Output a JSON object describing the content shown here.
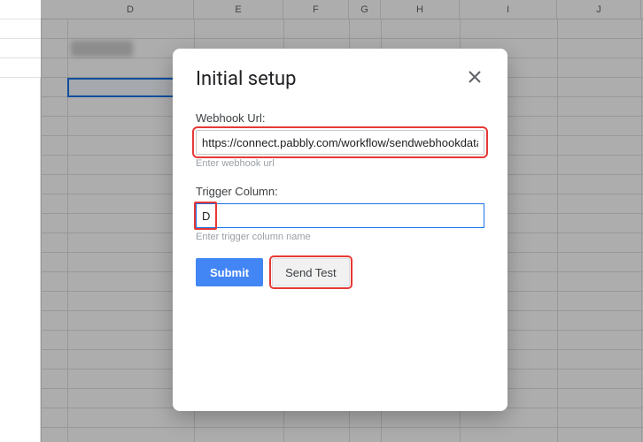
{
  "columns": {
    "D": "D",
    "E": "E",
    "F": "F",
    "G": "G",
    "H": "H",
    "I": "I",
    "J": "J"
  },
  "dialog": {
    "title": "Initial setup",
    "webhook": {
      "label": "Webhook Url:",
      "value": "https://connect.pabbly.com/workflow/sendwebhookdata",
      "hint": "Enter webhook url"
    },
    "trigger": {
      "label": "Trigger Column:",
      "value": "D",
      "hint": "Enter trigger column name"
    },
    "buttons": {
      "submit": "Submit",
      "send_test": "Send Test"
    }
  }
}
